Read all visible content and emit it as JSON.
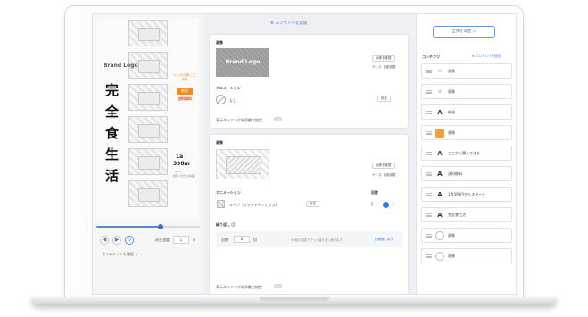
{
  "left": {
    "brand": "Brand Logo",
    "kanji": [
      "完",
      "全",
      "食",
      "生",
      "活"
    ],
    "tag_orange": "いつもの新しさ体験",
    "tag_box": "無添",
    "tag_red": "送料無料",
    "stat_big": "1a",
    "stat_big2": "398m",
    "stat_small": "99%",
    "stat_small2": "原料 1日分の栄養",
    "slider_progress": 0.62,
    "speed_label": "再生速度",
    "speed_value": "1",
    "speed_unit": "x",
    "timeline": "タイムラインを確認 ⌄"
  },
  "editor": {
    "top_link": "⊕ コンテンツを追加",
    "card1": {
      "title": "画像",
      "logo_text": "Brand Logo",
      "replace_btn": "画像を差替",
      "size": "サイズ: 自動調整",
      "anim_label": "アニメーション",
      "anim_value": "なし",
      "settings_btn": "設定",
      "timing": "表示タイミングを手動で指定"
    },
    "card2": {
      "title": "画像",
      "replace_btn": "画像を差替",
      "size": "サイズ: 自動調整",
      "anim_label": "アニメーション",
      "anim_value": "ループ（スライドインとボス）",
      "settings_btn": "設定",
      "loop_label": "繰り返し",
      "side_label": "回数",
      "repeat_label": "繰り返し ⓘ",
      "count_label": "回数",
      "count_value": "0",
      "count_unit": "回",
      "note": "※0回の指定でずっと繰り返し続けます",
      "reset_link": "初期値に戻す",
      "timing": "表示タイミングを手動で指定"
    }
  },
  "layers": {
    "preview_btn": "全体を再生 ▷",
    "head": "コンテンツ",
    "add": "⊕ コンテンツを追加",
    "items": [
      {
        "icon": "≡",
        "type": "bars",
        "name": "画像"
      },
      {
        "icon": "≡",
        "type": "bars",
        "name": "画像"
      },
      {
        "icon": "A",
        "type": "text",
        "name": "新発"
      },
      {
        "icon": "",
        "type": "swatch",
        "name": "画像"
      },
      {
        "icon": "A",
        "type": "text",
        "name": "ここから購入できる"
      },
      {
        "icon": "A",
        "type": "text",
        "name": "送料無料"
      },
      {
        "icon": "A",
        "type": "text",
        "name": "1食398円からスタート"
      },
      {
        "icon": "A",
        "type": "text",
        "name": "完全食生活"
      },
      {
        "icon": "",
        "type": "ring",
        "name": "画像"
      },
      {
        "icon": "",
        "type": "ring",
        "name": "画像"
      }
    ]
  }
}
